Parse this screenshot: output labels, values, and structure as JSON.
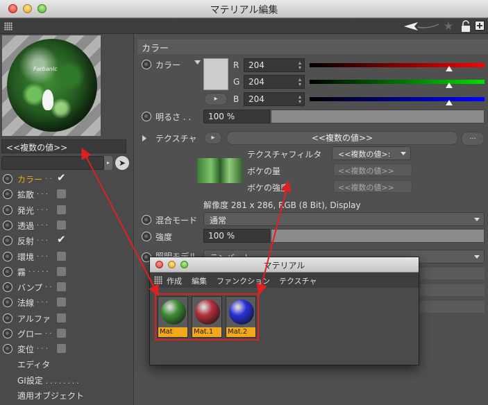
{
  "window": {
    "title": "マテリアル編集"
  },
  "preview": {
    "label": "Farbanlc"
  },
  "left": {
    "name_value": "<<複数の値>>",
    "channels": [
      {
        "label": "カラー",
        "dots": ". .",
        "checked": true,
        "active": true
      },
      {
        "label": "拡散",
        "dots": ". . .",
        "checked": false,
        "active": false
      },
      {
        "label": "発光",
        "dots": ". . .",
        "checked": false,
        "active": false
      },
      {
        "label": "透過",
        "dots": ". . .",
        "checked": false,
        "active": false
      },
      {
        "label": "反射",
        "dots": ". . .",
        "checked": true,
        "active": false
      },
      {
        "label": "環境",
        "dots": ". . .",
        "checked": false,
        "active": false
      },
      {
        "label": "霧",
        "dots": ". . . . .",
        "checked": false,
        "active": false
      },
      {
        "label": "バンプ",
        "dots": ". .",
        "checked": false,
        "active": false
      },
      {
        "label": "法線",
        "dots": ". . .",
        "checked": false,
        "active": false
      },
      {
        "label": "アルファ",
        "dots": "",
        "checked": false,
        "active": false
      },
      {
        "label": "グロー",
        "dots": ". .",
        "checked": false,
        "active": false
      },
      {
        "label": "変位",
        "dots": ". . .",
        "checked": false,
        "active": false
      }
    ],
    "extras": [
      {
        "label": "エディタ",
        "dots": ""
      },
      {
        "label": "GI設定",
        "dots": ". . . . . . . ."
      },
      {
        "label": "適用オブジェクト",
        "dots": ""
      }
    ]
  },
  "color": {
    "section_title": "カラー",
    "color_label": "カラー",
    "r_label": "R",
    "g_label": "G",
    "b_label": "B",
    "r": "204",
    "g": "204",
    "b": "204",
    "swatch": "#cccccc",
    "brightness_label": "明るさ",
    "brightness_dots": ". .",
    "brightness": "100 %",
    "texture_label": "テクスチャ",
    "texture_value": "<<複数の値>>",
    "more_btn": "...",
    "filter_label": "テクスチャフィルタ",
    "filter_value": "<<複数の値>:",
    "blur_amount_label": "ボケの量",
    "blur_amount_value": "<<複数の値>>",
    "blur_strength_label": "ボケの強度",
    "blur_strength_value": "<<複数の値>>",
    "resolution": "解像度 281 x 286, RGB (8 Bit), Display",
    "blend_label": "混合モード",
    "blend_value": "通常",
    "strength_label": "強度",
    "strength_value": "100 %",
    "model_label_partial": "照明モデル",
    "model_value_partial": "ランバート"
  },
  "material_window": {
    "title": "マテリアル",
    "menu": [
      "作成",
      "編集",
      "ファンクション",
      "テクスチャ"
    ],
    "materials": [
      {
        "name": "Mat",
        "color": "#3f8e36"
      },
      {
        "name": "Mat.1",
        "color": "#b3303a"
      },
      {
        "name": "Mat.2",
        "color": "#2832d8"
      }
    ]
  },
  "colors": {
    "accent": "#f2a81b",
    "annotation": "#e02020"
  }
}
